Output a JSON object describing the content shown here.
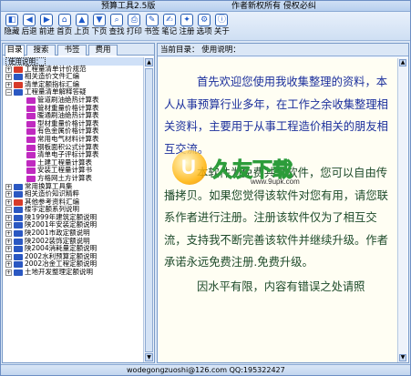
{
  "titlebar": {
    "title": "预算工具2.5版",
    "right_text": "作者新权所有  侵权必纠"
  },
  "toolbar": {
    "buttons": [
      {
        "label": "隐藏",
        "icon": "hide-icon"
      },
      {
        "label": "后退",
        "icon": "back-icon"
      },
      {
        "label": "前进",
        "icon": "forward-icon"
      },
      {
        "label": "首页",
        "icon": "home-icon"
      },
      {
        "label": "上页",
        "icon": "prev-page-icon"
      },
      {
        "label": "下页",
        "icon": "next-page-icon"
      },
      {
        "label": "查找",
        "icon": "find-icon"
      },
      {
        "label": "打印",
        "icon": "print-icon"
      },
      {
        "label": "书签",
        "icon": "bookmark-icon"
      },
      {
        "label": "笔记",
        "icon": "note-icon"
      },
      {
        "label": "注册",
        "icon": "register-icon"
      },
      {
        "label": "选项",
        "icon": "options-icon"
      },
      {
        "label": "关于",
        "icon": "about-icon"
      }
    ]
  },
  "left_panel": {
    "tabs": [
      "目录",
      "搜索",
      "书签",
      "费用"
    ],
    "tree": [
      {
        "label": "使用说明：",
        "level": 0,
        "expander": "",
        "book": "",
        "selected": true
      },
      {
        "label": "工程量清单计价规范",
        "level": 0,
        "expander": "+",
        "book": "red"
      },
      {
        "label": "相关造价文件汇编",
        "level": 0,
        "expander": "+",
        "book": "blue"
      },
      {
        "label": "清单定额指标汇编",
        "level": 0,
        "expander": "+",
        "book": "red"
      },
      {
        "label": "工程量清单解释答疑",
        "level": 0,
        "expander": "−",
        "book": "blue"
      },
      {
        "label": "管道刷油绝热计算表",
        "level": 1,
        "expander": "",
        "book": "magenta"
      },
      {
        "label": "管材重量价格计算表",
        "level": 1,
        "expander": "",
        "book": "magenta"
      },
      {
        "label": "暖通刷油绝热计算表",
        "level": 1,
        "expander": "",
        "book": "magenta"
      },
      {
        "label": "型材重量价格计算表",
        "level": 1,
        "expander": "",
        "book": "magenta"
      },
      {
        "label": "有色金属价格计算表",
        "level": 1,
        "expander": "",
        "book": "magenta"
      },
      {
        "label": "常用电气材料计算表",
        "level": 1,
        "expander": "",
        "book": "magenta"
      },
      {
        "label": "钢板面积公式计算表",
        "level": 1,
        "expander": "",
        "book": "magenta"
      },
      {
        "label": "清单电子评标计算表",
        "level": 1,
        "expander": "",
        "book": "magenta"
      },
      {
        "label": "土建工程量计算表",
        "level": 1,
        "expander": "",
        "book": "magenta"
      },
      {
        "label": "安装工程量计算书",
        "level": 1,
        "expander": "",
        "book": "magenta"
      },
      {
        "label": "方格网土方计算表",
        "level": 1,
        "expander": "",
        "book": "magenta"
      },
      {
        "label": "常用换算工具集",
        "level": 0,
        "expander": "+",
        "book": "blue"
      },
      {
        "label": "相关造价知识精粹",
        "level": 0,
        "expander": "+",
        "book": "blue"
      },
      {
        "label": "其他参考资料汇编",
        "level": 0,
        "expander": "+",
        "book": "red"
      },
      {
        "label": "楼宇定额系列说明",
        "level": 0,
        "expander": "−",
        "book": "blue"
      },
      {
        "label": "陕1999年建筑定额说明",
        "level": 0,
        "expander": "+",
        "book": "blue"
      },
      {
        "label": "陕2001年安装定额说明",
        "level": 0,
        "expander": "+",
        "book": "blue"
      },
      {
        "label": "陕2001市政定额说明",
        "level": 0,
        "expander": "+",
        "book": "blue"
      },
      {
        "label": "陕2002装饰定额说明",
        "level": 0,
        "expander": "+",
        "book": "blue"
      },
      {
        "label": "陕2004消耗量定额说明",
        "level": 0,
        "expander": "+",
        "book": "blue"
      },
      {
        "label": "2002水利预算定额说明",
        "level": 0,
        "expander": "+",
        "book": "blue"
      },
      {
        "label": "2002冶金工程定额说明",
        "level": 0,
        "expander": "+",
        "book": "blue"
      },
      {
        "label": "土地开发整理定额说明",
        "level": 0,
        "expander": "+",
        "book": "blue"
      }
    ]
  },
  "right_panel": {
    "position_label": "当前目录： 使用说明：",
    "paragraphs": [
      "首先欢迎您使用我收集整理的资料，本人从事预算行业多年，在工作之余收集整理相关资料，主要用于从事工程造价相关的朋友相互交流。",
      "本软件为免费共享软件，您可以自由传播拷贝。如果您觉得该软件对您有用，请您联系作者进行注册。注册该软件仅为了相互交流，支持我不断完善该软件并继续升级。作者承诺永远免费注册.免费升级。",
      "因水平有限，内容有错误之处请照"
    ]
  },
  "watermark": {
    "brand": "久友下载",
    "url": "www.9upk.com"
  },
  "statusbar": {
    "text": "wodegongzuoshi@126.com  QQ:195322427"
  },
  "colors": {
    "accent": "#1d59c9",
    "panel_bg": "#dbe7f6",
    "content_text": "#1b2f9c"
  }
}
